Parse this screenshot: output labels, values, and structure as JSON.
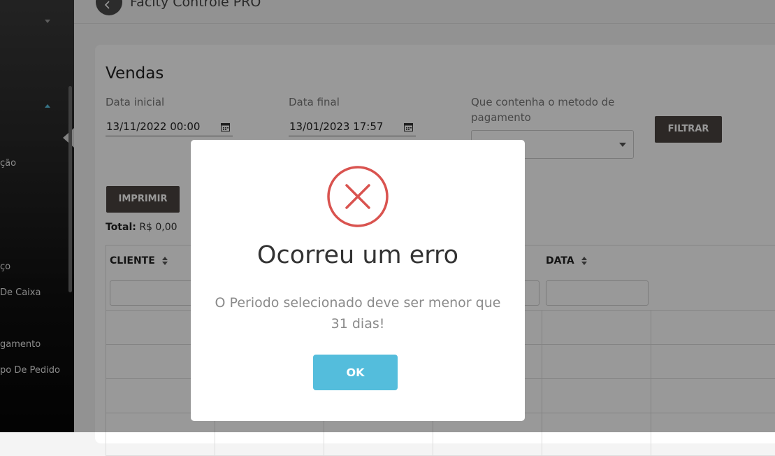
{
  "app": {
    "title": "Facity Controle PRO"
  },
  "sidebar": {
    "items": [
      {
        "label": "ção"
      },
      {
        "label": "ço"
      },
      {
        "label": "De Caixa"
      },
      {
        "label": "gamento"
      },
      {
        "label": "po De Pedido"
      }
    ]
  },
  "vendas": {
    "title": "Vendas",
    "filters": {
      "data_inicial_label": "Data inicial",
      "data_inicial_value": "13/11/2022 00:00",
      "data_final_label": "Data final",
      "data_final_value": "13/01/2023 17:57",
      "metodo_label": "Que contenha o metodo de pagamento",
      "filtrar_label": "FILTRAR"
    },
    "imprimir_label": "IMPRIMIR",
    "total_label": "Total:",
    "total_value": "R$ 0,00",
    "table": {
      "columns": [
        "CLIENTE",
        "DATA"
      ]
    }
  },
  "modal": {
    "title": "Ocorreu um erro",
    "message": "O Periodo selecionado deve ser menor que 31 dias!",
    "ok_label": "OK",
    "icon": "error-x-icon",
    "icon_color": "#d9534f",
    "button_color": "#54bddc"
  }
}
